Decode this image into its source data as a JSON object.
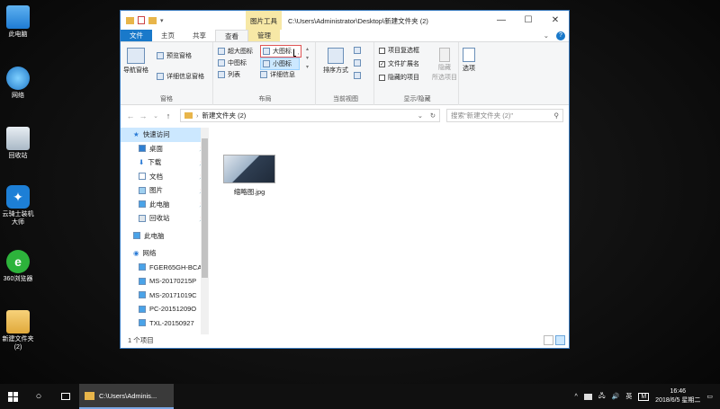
{
  "desktop": {
    "icons": [
      {
        "label": "此电脑",
        "icon": "computer-icon"
      },
      {
        "label": "网络",
        "icon": "network-icon"
      },
      {
        "label": "回收站",
        "icon": "recycle-bin-icon"
      },
      {
        "label": "云骑士装机大师",
        "icon": "app-icon"
      },
      {
        "label": "360浏览器",
        "icon": "browser-icon"
      },
      {
        "label": "新建文件夹 (2)",
        "icon": "folder-icon"
      }
    ]
  },
  "window": {
    "context_tab": "图片工具",
    "title": "C:\\Users\\Administrator\\Desktop\\新建文件夹 (2)",
    "tabs": [
      "文件",
      "主页",
      "共享",
      "查看",
      "管理"
    ],
    "ribbon": {
      "pane_group": {
        "nav_pane": "导航窗格",
        "preview": "预览窗格",
        "details": "详细信息窗格",
        "label": "窗格"
      },
      "layout_group": {
        "items": [
          "超大图标",
          "大图标",
          "中图标",
          "小图标",
          "列表",
          "详细信息"
        ],
        "label": "布局"
      },
      "view_group": {
        "sort": "排序方式",
        "label": "当前视图"
      },
      "show_group": {
        "checkbox_item": "项目复选框",
        "extensions": "文件扩展名",
        "hidden": "隐藏的项目",
        "hide_selected": "隐藏",
        "hide_selected2": "所选项目",
        "label": "显示/隐藏"
      },
      "options": "选项"
    },
    "address": {
      "path": "新建文件夹 (2)",
      "search_placeholder": "搜索\"新建文件夹 (2)\""
    },
    "nav": {
      "quick_access": "快速访问",
      "pinned": [
        "桌面",
        "下载",
        "文档",
        "图片",
        "此电脑",
        "回收站"
      ],
      "this_pc": "此电脑",
      "network": "网络",
      "network_items": [
        "FGER65GH-BCA",
        "MS-20170215P",
        "MS-20171019C",
        "PC-20151209O",
        "TXL-20150927"
      ]
    },
    "file": {
      "name": "缩略图.jpg"
    },
    "status": "1 个项目"
  },
  "taskbar": {
    "app_label": "C:\\Users\\Adminis...",
    "lang": "英",
    "ime": "M",
    "time": "16:46",
    "date": "2018/6/5 星期二"
  }
}
